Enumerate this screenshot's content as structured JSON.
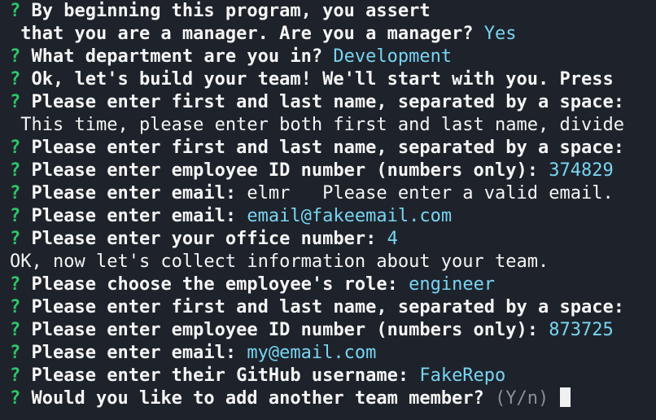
{
  "terminal": {
    "prompt_symbol": "?",
    "lines": [
      {
        "kind": "q",
        "question": "By beginning this program, you assert",
        "answer": ""
      },
      {
        "kind": "cont",
        "question": " that you are a manager. Are you a manager? ",
        "answer": "Yes"
      },
      {
        "kind": "q",
        "question": "What department are you in? ",
        "answer": "Development"
      },
      {
        "kind": "q",
        "question": "Ok, let's build your team! We'll start with you. Press",
        "answer": ""
      },
      {
        "kind": "q",
        "question": "Please enter first and last name, separated by a space:",
        "answer": ""
      },
      {
        "kind": "plain",
        "text": " This time, please enter both first and last name, divide"
      },
      {
        "kind": "q",
        "question": "Please enter first and last name, separated by a space:",
        "answer": ""
      },
      {
        "kind": "q",
        "question": "Please enter employee ID number (numbers only): ",
        "answer": "374829"
      },
      {
        "kind": "q",
        "question": "Please enter email: ",
        "raw": "elmr   Please enter a valid email."
      },
      {
        "kind": "q",
        "question": "Please enter email: ",
        "answer": "email@fakeemail.com"
      },
      {
        "kind": "q",
        "question": "Please enter your office number: ",
        "answer": "4"
      },
      {
        "kind": "plain",
        "text": "OK, now let's collect information about your team."
      },
      {
        "kind": "q",
        "question": "Please choose the employee's role: ",
        "answer": "engineer"
      },
      {
        "kind": "q",
        "question": "Please enter first and last name, separated by a space:",
        "answer": ""
      },
      {
        "kind": "q",
        "question": "Please enter employee ID number (numbers only): ",
        "answer": "873725"
      },
      {
        "kind": "q",
        "question": "Please enter email: ",
        "answer": "my@email.com"
      },
      {
        "kind": "q",
        "question": "Please enter their GitHub username: ",
        "answer": "FakeRepo"
      },
      {
        "kind": "q",
        "question": "Would you like to add another team member? ",
        "hint": "(Y/n)",
        "cursor": true
      }
    ]
  },
  "colors": {
    "background": "#1e232b",
    "prompt": "#2fc56a",
    "answer": "#79d4f2",
    "text": "#f5f5f5",
    "hint": "#8a8f97"
  }
}
